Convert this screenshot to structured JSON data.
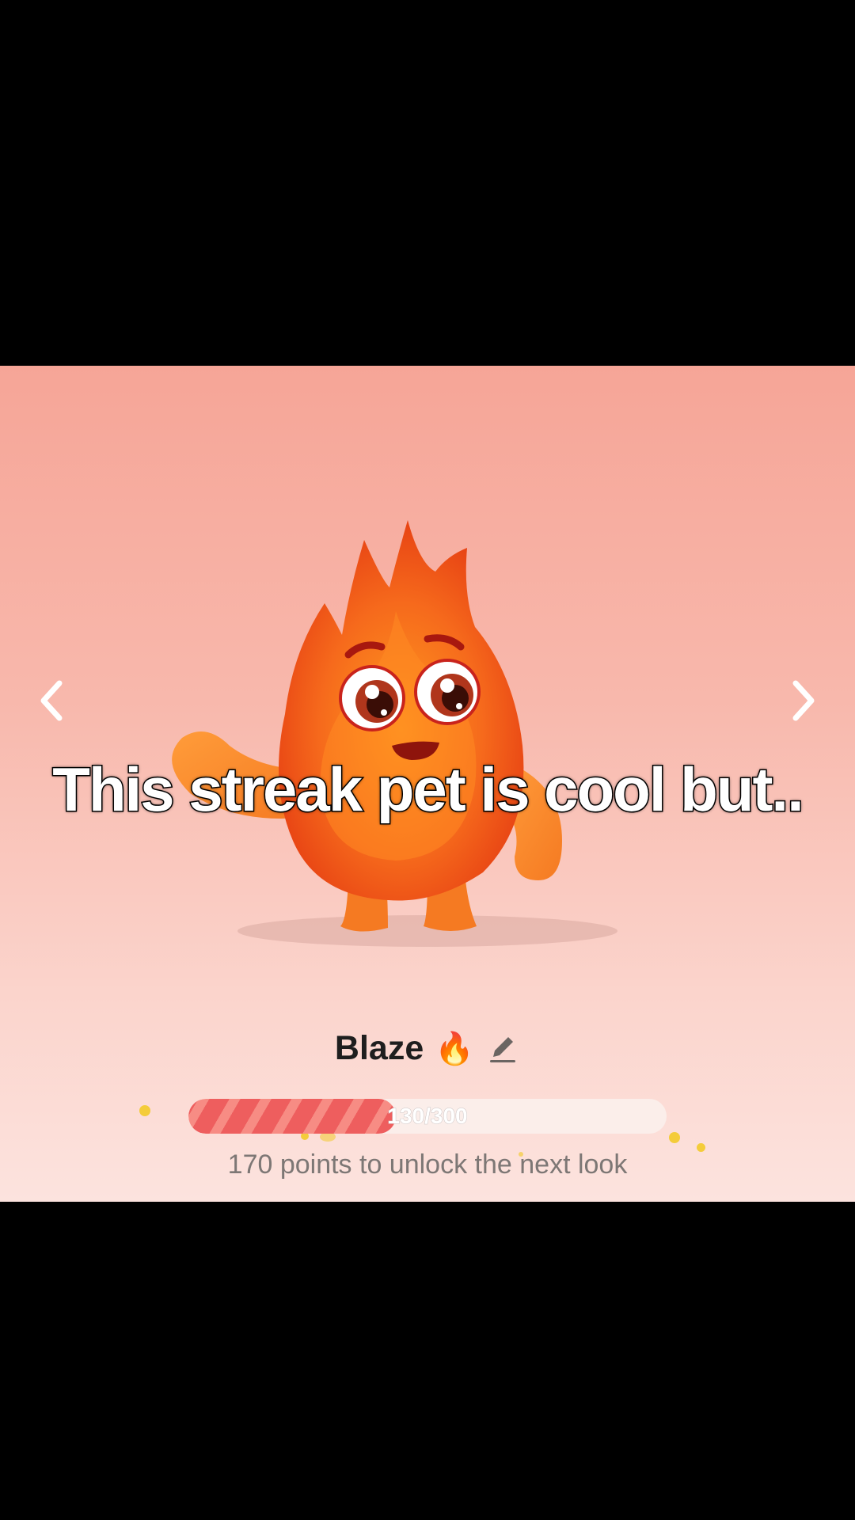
{
  "caption": "This streak pet is cool but..",
  "pet": {
    "name": "Blaze",
    "name_emoji": "🔥",
    "edit_icon": "pencil-icon"
  },
  "progress": {
    "label": "130/300",
    "current": 130,
    "max": 300,
    "hint": "170 points to unlock the next look"
  },
  "nav": {
    "prev_icon": "chevron-left-icon",
    "next_icon": "chevron-right-icon"
  },
  "colors": {
    "progress_fill": "#ee5e5e",
    "progress_track": "#fbeeea",
    "pet_primary": "#f2641f",
    "background_top": "#f6a597",
    "background_bottom": "#fce3de"
  }
}
